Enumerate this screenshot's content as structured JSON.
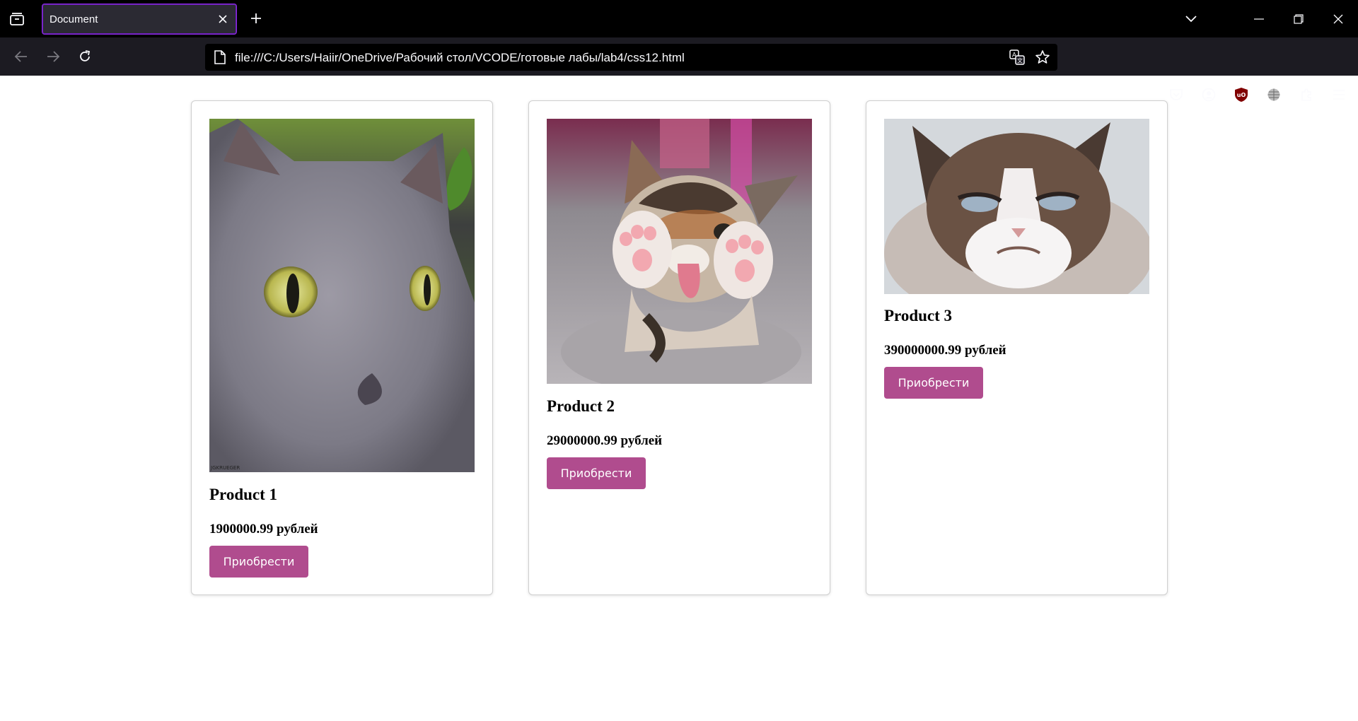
{
  "browser": {
    "tab_title": "Document",
    "url": "file:///C:/Users/Haiir/OneDrive/Рабочий стол/VCODE/готовые лабы/lab4/css12.html",
    "icons": [
      "tab-list-icon",
      "close-icon",
      "plus-icon",
      "chevron-down-icon",
      "minimize-icon",
      "restore-icon",
      "window-close-icon",
      "back-icon",
      "forward-icon",
      "reload-icon",
      "page-icon",
      "translate-icon",
      "star-icon",
      "pocket-icon",
      "account-icon",
      "ublock-icon",
      "globe-icon",
      "extensions-icon",
      "menu-icon"
    ],
    "colors": {
      "tab_border": "#8a2be2",
      "toolbar_bg": "#1c1b22",
      "tabbar_bg": "#000000"
    }
  },
  "products": [
    {
      "title": "Product 1",
      "price": "1900000.99 рублей",
      "button": "Приобрести",
      "image": "grey-cat-photo",
      "image_caption": "JGKRUEGER"
    },
    {
      "title": "Product 2",
      "price": "29000000.99 рублей",
      "button": "Приобрести",
      "image": "kitten-paws-photo"
    },
    {
      "title": "Product 3",
      "price": "390000000.99 рублей",
      "button": "Приобрести",
      "image": "grumpy-cat-photo"
    }
  ],
  "colors": {
    "button_bg": "#b04c8e",
    "button_text": "#ffffff"
  }
}
